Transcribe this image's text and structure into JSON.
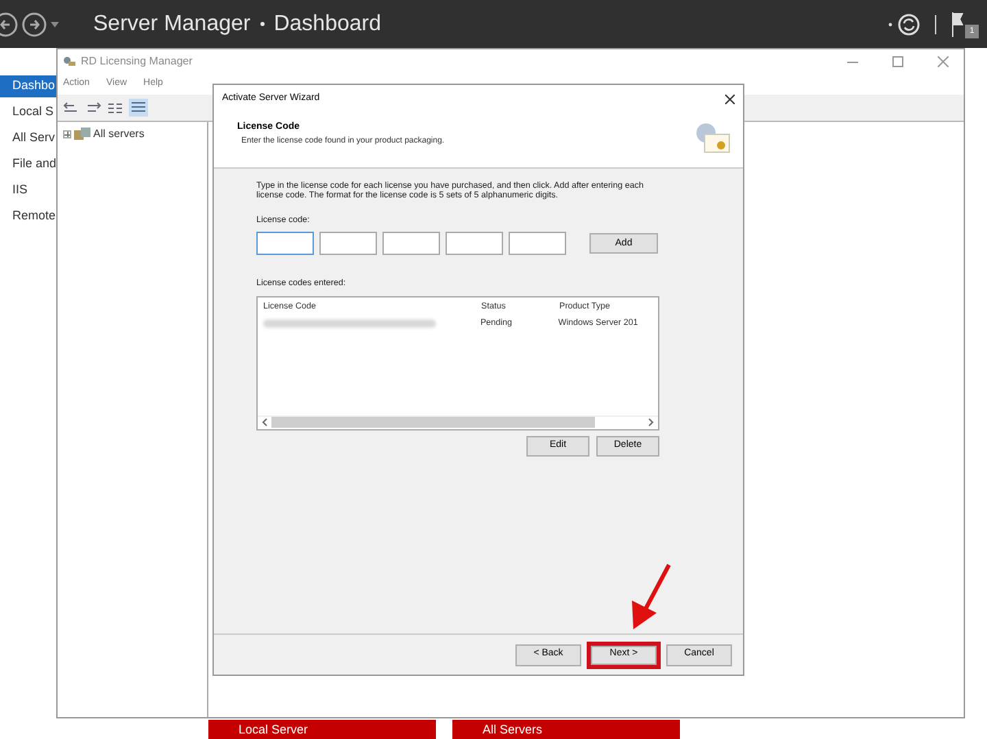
{
  "server_manager": {
    "title": "Server Manager",
    "page": "Dashboard",
    "notification_count": "1",
    "sidebar": [
      {
        "label": "Dashbo",
        "selected": true
      },
      {
        "label": "Local S",
        "selected": false
      },
      {
        "label": "All Serv",
        "selected": false
      },
      {
        "label": "File and",
        "selected": false
      },
      {
        "label": "IIS",
        "selected": false
      },
      {
        "label": "Remote",
        "selected": false
      }
    ],
    "tiles": [
      "Local Server",
      "All Servers"
    ]
  },
  "licensing_manager": {
    "title": "RD Licensing Manager",
    "menu": [
      "Action",
      "View",
      "Help"
    ],
    "tree": [
      {
        "label": "All servers",
        "expanded": false
      }
    ]
  },
  "wizard": {
    "title": "Activate Server Wizard",
    "heading": "License Code",
    "subheading": "Enter the license code found in your product packaging.",
    "instructions": "Type in the license code for each license you have purchased, and then click. Add after entering each license code. The format for the license code is 5 sets of 5 alphanumeric digits.",
    "code_label": "License code:",
    "add_button": "Add",
    "entered_label": "License codes entered:",
    "columns": [
      "License Code",
      "Status",
      "Product Type"
    ],
    "rows": [
      {
        "status": "Pending",
        "product_type": "Windows Server 201"
      }
    ],
    "list_buttons": [
      "Edit",
      "Delete"
    ],
    "footer_buttons": [
      {
        "label": "< Back",
        "highlighted": false
      },
      {
        "label": "Next >",
        "highlighted": true
      },
      {
        "label": "Cancel",
        "highlighted": false
      }
    ]
  }
}
